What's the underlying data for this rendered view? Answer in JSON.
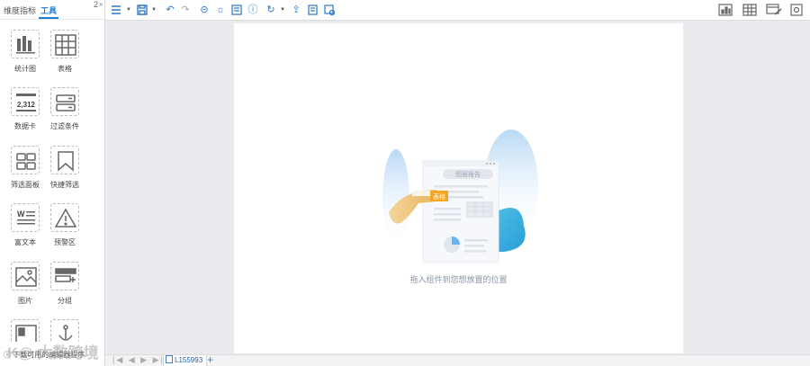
{
  "left_panel": {
    "tabs": [
      "维度指标",
      "工具"
    ],
    "active_tab": "工具",
    "badge": "2",
    "tools": [
      {
        "label": "统计图",
        "icon": "bar-chart-icon"
      },
      {
        "label": "表格",
        "icon": "table-grid-icon"
      },
      {
        "label": "数据卡",
        "icon": "number-card-icon",
        "icon_text": "2,312"
      },
      {
        "label": "过滤条件",
        "icon": "filter-condition-icon"
      },
      {
        "label": "筛选面板",
        "icon": "filter-panel-icon"
      },
      {
        "label": "快捷筛选",
        "icon": "bookmark-filter-icon"
      },
      {
        "label": "富文本",
        "icon": "rich-text-icon",
        "icon_text": "W"
      },
      {
        "label": "预警区",
        "icon": "warning-icon"
      },
      {
        "label": "图片",
        "icon": "image-icon"
      },
      {
        "label": "分组",
        "icon": "group-icon"
      },
      {
        "label": "",
        "icon": "layout-icon"
      },
      {
        "label": "",
        "icon": "anchor-icon"
      }
    ],
    "footer_text": "ⓘ 下载可用的编辑器程序",
    "watermark": "K@ 大数跨境"
  },
  "toolbar": {
    "left_icons": [
      "menu-icon",
      "save-icon",
      "undo-icon",
      "redo-icon",
      "link-icon",
      "light-icon",
      "layout-icon",
      "info-icon",
      "refresh-icon",
      "export-icon",
      "share-icon",
      "preview-icon"
    ],
    "right_icons": [
      "report-icon",
      "grid-icon",
      "theme-icon",
      "settings-icon"
    ]
  },
  "canvas": {
    "placeholder_text": "拖入组件到您想放置的位置",
    "illustration_card_title": "图层报告",
    "illustration_tag": "表格"
  },
  "bottom": {
    "nav": "|◀ ◀ ▶ ▶|",
    "sheet_name": "L155993",
    "add_label": "+"
  },
  "colors": {
    "accent": "#1d7dd6",
    "canvas_bg": "#ffffff",
    "workspace_bg": "#e9ebee"
  }
}
